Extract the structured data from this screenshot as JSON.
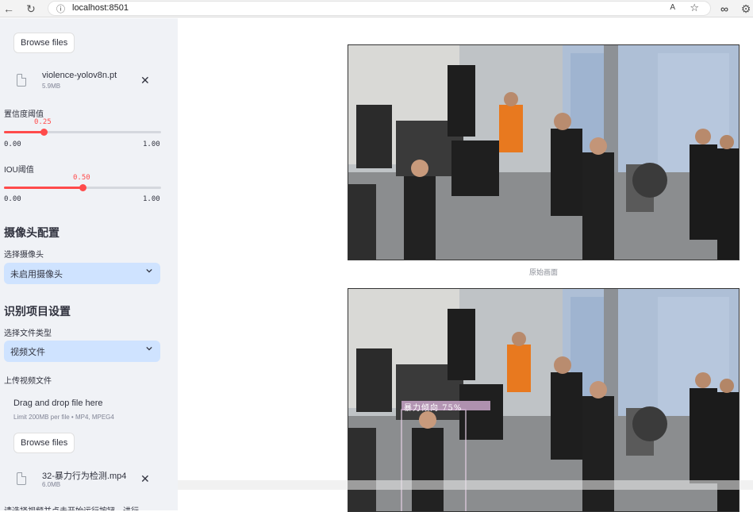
{
  "browser": {
    "url": "localhost:8501"
  },
  "sidebar": {
    "model_upload": {
      "browse_label": "Browse files",
      "file_name": "violence-yolov8n.pt",
      "file_size": "5.9MB"
    },
    "confidence_slider": {
      "label": "置信度阈值",
      "value": "0.25",
      "value_fraction": 0.25,
      "min": "0.00",
      "max": "1.00"
    },
    "iou_slider": {
      "label": "IOU阈值",
      "value": "0.50",
      "value_fraction": 0.5,
      "min": "0.00",
      "max": "1.00"
    },
    "camera_section": {
      "title": "摄像头配置",
      "select_label": "选择摄像头",
      "select_value": "未启用摄像头"
    },
    "recognition_section": {
      "title": "识别项目设置",
      "type_label": "选择文件类型",
      "type_value": "视频文件",
      "upload_label": "上传视频文件",
      "dropzone_title": "Drag and drop file here",
      "dropzone_limit": "Limit 200MB per file • MP4, MPEG4",
      "browse_label": "Browse files",
      "file_name": "32-暴力行为检测.mp4",
      "file_size": "6.0MB",
      "footer_text": "请选择视频并点击开始运行按钮，进行"
    }
  },
  "main": {
    "original_caption": "原始画面",
    "detection_label": "暴力倾向 75%"
  },
  "colors": {
    "accent": "#ff4b4b",
    "select_bg": "#cfe3ff",
    "sidebar_bg": "#f0f2f6"
  }
}
